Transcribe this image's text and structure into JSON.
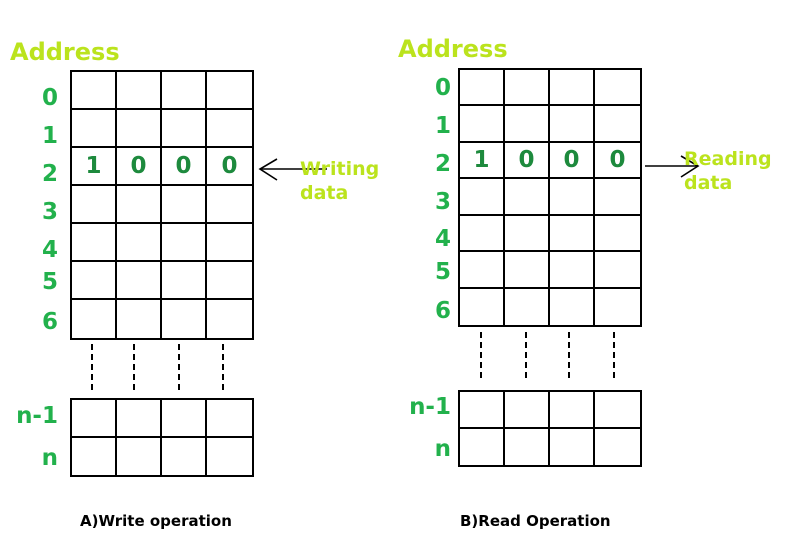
{
  "figure": {
    "title_a": "A)Write operation",
    "title_b": "B)Read Operation"
  },
  "colors": {
    "heading_green": "#bbe31d",
    "address_green": "#22b14c",
    "data_green": "#1d8a3d",
    "grid_black": "#000000",
    "background": "#ffffff"
  },
  "panels": [
    {
      "id": "write",
      "address_heading": "Address",
      "caption": "A)Write operation",
      "annotation": {
        "line1": "Writing",
        "line2": "data",
        "direction": "left",
        "icon": "arrow-left-icon"
      },
      "top_block": {
        "row_labels": [
          "0",
          "1",
          "2",
          "3",
          "4",
          "5",
          "6"
        ],
        "columns": 4,
        "rows": [
          [
            "",
            "",
            "",
            ""
          ],
          [
            "",
            "",
            "",
            ""
          ],
          [
            "1",
            "0",
            "0",
            "0"
          ],
          [
            "",
            "",
            "",
            ""
          ],
          [
            "",
            "",
            "",
            ""
          ],
          [
            "",
            "",
            "",
            ""
          ],
          [
            "",
            "",
            "",
            ""
          ]
        ]
      },
      "ellipsis": {
        "symbol": "vertical-dashes",
        "count": 4
      },
      "bottom_block": {
        "row_labels": [
          "n-1",
          "n"
        ],
        "columns": 4,
        "rows": [
          [
            "",
            "",
            "",
            ""
          ],
          [
            "",
            "",
            "",
            ""
          ]
        ]
      }
    },
    {
      "id": "read",
      "address_heading": "Address",
      "caption": "B)Read Operation",
      "annotation": {
        "line1": "Reading",
        "line2": "data",
        "direction": "right",
        "icon": "arrow-right-icon"
      },
      "top_block": {
        "row_labels": [
          "0",
          "1",
          "2",
          "3",
          "4",
          "5",
          "6"
        ],
        "columns": 4,
        "rows": [
          [
            "",
            "",
            "",
            ""
          ],
          [
            "",
            "",
            "",
            ""
          ],
          [
            "1",
            "0",
            "0",
            "0"
          ],
          [
            "",
            "",
            "",
            ""
          ],
          [
            "",
            "",
            "",
            ""
          ],
          [
            "",
            "",
            "",
            ""
          ],
          [
            "",
            "",
            "",
            ""
          ]
        ]
      },
      "ellipsis": {
        "symbol": "vertical-dashes",
        "count": 4
      },
      "bottom_block": {
        "row_labels": [
          "n-1",
          "n"
        ],
        "columns": 4,
        "rows": [
          [
            "",
            "",
            "",
            ""
          ],
          [
            "",
            "",
            "",
            ""
          ]
        ]
      }
    }
  ]
}
